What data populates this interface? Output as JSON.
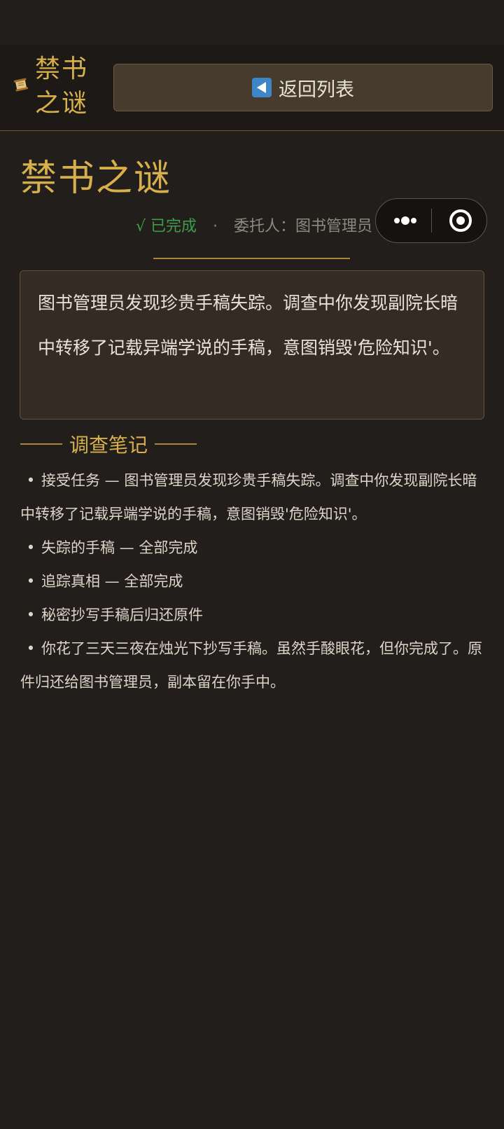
{
  "header": {
    "app_title": "禁书之谜",
    "back_label": "返回列表"
  },
  "quest": {
    "title": "禁书之谜",
    "status": "√ 已完成",
    "separator": "·",
    "client": "委托人：图书管理员",
    "description": "图书管理员发现珍贵手稿失踪。调查中你发现副院长暗中转移了记载异端学说的手稿，意图销毁'危险知识'。"
  },
  "notes": {
    "heading": "调查笔记",
    "items": [
      "接受任务 — 图书管理员发现珍贵手稿失踪。调查中你发现副院长暗中转移了记载异端学说的手稿，意图销毁'危险知识'。",
      "失踪的手稿 — 全部完成",
      "追踪真相 — 全部完成",
      "秘密抄写手稿后归还原件",
      "你花了三天三夜在烛光下抄写手稿。虽然手酸眼花，但你完成了。原件归还给图书管理员，副本留在你手中。"
    ]
  },
  "icons": {
    "app": "scroll-icon",
    "back": "back-arrow-icon",
    "more": "more-dots-icon",
    "close": "record-circle-icon"
  },
  "colors": {
    "accent": "#d7b04c",
    "success": "#3f9d49",
    "background": "#221e1b"
  }
}
